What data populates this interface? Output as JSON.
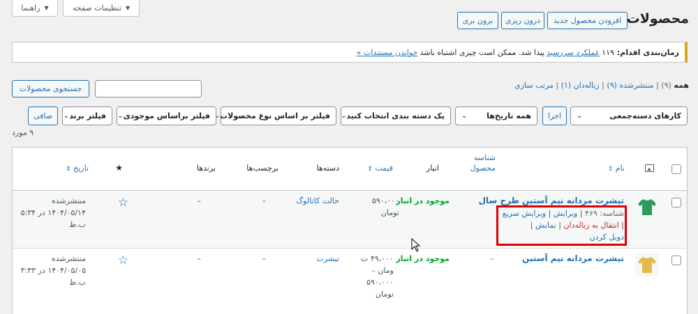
{
  "header": {
    "help_tab": "راهنما",
    "screen_options_tab": "تنظیمات صفحه",
    "page_title": "محصولات",
    "add_new": "افزودن محصول جدید",
    "import": "درون ریزی",
    "export": "برون بری"
  },
  "notice": {
    "label": "زمان‌بندی اقدام:",
    "text_1": "۱۱۹",
    "link_1": "عملکرد سررسید",
    "text_2": "پیدا شد. ممکن است چیزی اشتباه باشد",
    "link_2": "خواندن مستندات »"
  },
  "subsubsub": {
    "all": "همه",
    "all_count": "(۹)",
    "published": "منتشرشده (۹)",
    "trash": "زباله‌دان (۱)",
    "sort": "مرتب سازی"
  },
  "search": {
    "button": "جستجوی محصولات",
    "placeholder": ""
  },
  "filters": {
    "bulk_actions": "کارهای دسته‌جمعی",
    "apply": "اجرا",
    "all_dates": "همه تاریخ‌ها",
    "category": "یک دسته بندی انتخاب کنید",
    "product_type": "فیلتر بر اساس نوع محصولات",
    "stock": "فیلتر براساس موجودی",
    "brand": "فیلتر برند",
    "filter_button": "صافی"
  },
  "items_count": "۹ مورد",
  "columns": {
    "name": "نام",
    "sku": "شناسه محصول",
    "stock": "انبار",
    "price": "قیمت",
    "categories": "دسته‌ها",
    "tags": "برچسب‌ها",
    "brands": "برندها",
    "date": "تاریخ"
  },
  "rows": [
    {
      "name": "تیشرت مردانه نیم آستین طرح سال",
      "id_text": "شناسه: ۴۶۹",
      "edit": "ویرایش",
      "quick_edit": "ویرایش سریع",
      "trash": "انتقال به زباله‌دان",
      "view": "نمایش",
      "duplicate": "دوبل کردن",
      "sku": "–",
      "stock": "موجود در انبار",
      "price_1": "۵۹۰،۰۰۰",
      "price_2": "تومان",
      "category": "حالت کاتالوگ",
      "tags": "–",
      "brands": "–",
      "status": "منتشرشده",
      "date": "۱۴۰۴/۰۵/۱۴ در ۵:۳۴",
      "ampm": "ب.ظ"
    },
    {
      "name": "تیشرت مردانه نیم آستین",
      "sku": "–",
      "stock": "موجود در انبار",
      "price_1": "۴۹،۰۰۰ ت",
      "price_2": "ومان –",
      "price_3": "۵۹۰،۰۰۰",
      "price_4": "تومان",
      "category": "تیشرت",
      "tags": "–",
      "brands": "–",
      "status": "منتشرشده",
      "date": "۱۴۰۴/۰۵/۰۵ در ۳:۳۳",
      "ampm": "ب.ظ"
    }
  ],
  "colors": {
    "accent": "#2271b1",
    "in_stock": "#00a32a",
    "trash": "#b32d2e",
    "highlight": "#e00000",
    "shirt_green": "#2e9b5e",
    "shirt_yellow": "#e6b94c"
  },
  "icons": [
    "chevron-down-icon",
    "image-icon",
    "star-icon",
    "sort-arrow-icon",
    "tshirt-thumbnail",
    "cursor-icon"
  ]
}
